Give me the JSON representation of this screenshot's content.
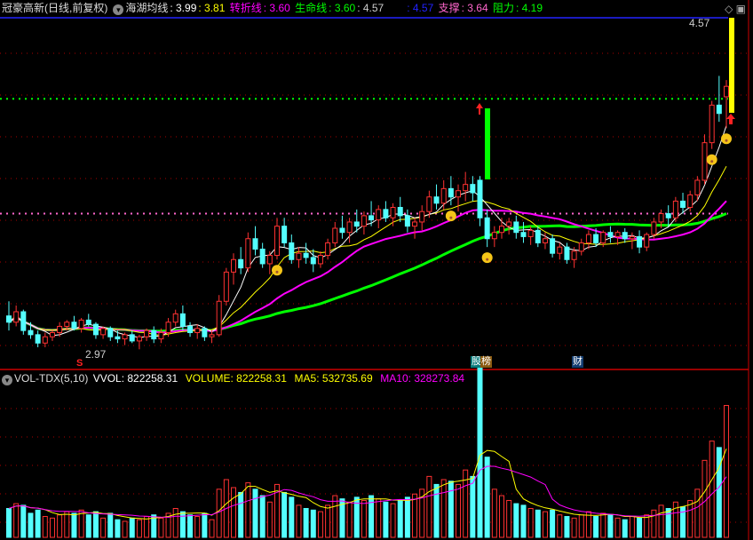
{
  "header": {
    "title": "冠豪高新(日线,前复权)",
    "ma_name": "海湖均线",
    "v1": ": 3.99",
    "v2": ": 3.81",
    "turn_label": "转折线",
    "turn_val": ": 3.60",
    "life_label": "生命线",
    "life_val": ": 3.60",
    "v3": ": 4.57",
    "v4": ": 4.57",
    "support_label": "支撑",
    "support_val": ": 3.64",
    "resist_label": "阻力",
    "resist_val": ": 4.19"
  },
  "vol_header": {
    "name": "VOL-TDX(5,10)",
    "vvol": "VVOL: 822258.31",
    "volume": "VOLUME: 822258.31",
    "ma5": "MA5: 532735.69",
    "ma10": "MA10: 328273.84"
  },
  "labels": {
    "high": "4.57",
    "low": "2.97",
    "tag1": "股",
    "tag2": "榜",
    "tag3": "财",
    "s_mark": "S"
  },
  "colors": {
    "up": "#ff3232",
    "down": "#54ffff",
    "ma_short": "#ffffff",
    "ma_mid": "#ffff00",
    "ma60": "#ff00ff",
    "ma120": "#00ff00",
    "grid": "#aa0000"
  },
  "price_range": [
    2.97,
    4.57
  ],
  "support": 3.64,
  "resistance": 4.19,
  "candles": [
    [
      3.15,
      3.22,
      3.08,
      3.12,
      180000
    ],
    [
      3.12,
      3.2,
      3.1,
      3.17,
      210000
    ],
    [
      3.17,
      3.18,
      3.06,
      3.08,
      200000
    ],
    [
      3.08,
      3.12,
      3.04,
      3.06,
      150000
    ],
    [
      3.06,
      3.08,
      3.0,
      3.02,
      170000
    ],
    [
      3.02,
      3.07,
      3.0,
      3.05,
      130000
    ],
    [
      3.05,
      3.08,
      3.03,
      3.07,
      120000
    ],
    [
      3.07,
      3.12,
      3.05,
      3.1,
      140000
    ],
    [
      3.1,
      3.13,
      3.08,
      3.12,
      160000
    ],
    [
      3.12,
      3.15,
      3.08,
      3.09,
      150000
    ],
    [
      3.09,
      3.14,
      3.07,
      3.13,
      170000
    ],
    [
      3.13,
      3.16,
      3.1,
      3.11,
      140000
    ],
    [
      3.11,
      3.12,
      3.04,
      3.06,
      160000
    ],
    [
      3.06,
      3.1,
      3.04,
      3.09,
      120000
    ],
    [
      3.09,
      3.1,
      3.03,
      3.05,
      150000
    ],
    [
      3.05,
      3.08,
      3.02,
      3.04,
      110000
    ],
    [
      3.04,
      3.07,
      3.01,
      3.06,
      100000
    ],
    [
      3.06,
      3.08,
      3.02,
      3.03,
      120000
    ],
    [
      3.03,
      3.06,
      2.99,
      3.05,
      110000
    ],
    [
      3.05,
      3.09,
      3.03,
      3.08,
      130000
    ],
    [
      3.08,
      3.1,
      3.02,
      3.04,
      140000
    ],
    [
      3.04,
      3.09,
      3.02,
      3.07,
      120000
    ],
    [
      3.07,
      3.14,
      3.05,
      3.12,
      150000
    ],
    [
      3.12,
      3.18,
      3.1,
      3.16,
      180000
    ],
    [
      3.16,
      3.2,
      3.08,
      3.1,
      160000
    ],
    [
      3.1,
      3.12,
      3.05,
      3.07,
      140000
    ],
    [
      3.07,
      3.11,
      3.04,
      3.09,
      130000
    ],
    [
      3.09,
      3.1,
      3.03,
      3.05,
      150000
    ],
    [
      3.05,
      3.08,
      3.02,
      3.06,
      110000
    ],
    [
      3.06,
      3.25,
      3.05,
      3.22,
      300000
    ],
    [
      3.22,
      3.38,
      3.2,
      3.36,
      360000
    ],
    [
      3.36,
      3.45,
      3.3,
      3.42,
      310000
    ],
    [
      3.42,
      3.48,
      3.35,
      3.38,
      280000
    ],
    [
      3.38,
      3.55,
      3.36,
      3.52,
      340000
    ],
    [
      3.52,
      3.58,
      3.44,
      3.47,
      300000
    ],
    [
      3.47,
      3.5,
      3.38,
      3.4,
      260000
    ],
    [
      3.4,
      3.46,
      3.35,
      3.44,
      220000
    ],
    [
      3.44,
      3.62,
      3.42,
      3.58,
      330000
    ],
    [
      3.58,
      3.62,
      3.48,
      3.5,
      280000
    ],
    [
      3.5,
      3.54,
      3.4,
      3.42,
      250000
    ],
    [
      3.42,
      3.48,
      3.38,
      3.45,
      200000
    ],
    [
      3.45,
      3.5,
      3.4,
      3.43,
      180000
    ],
    [
      3.43,
      3.47,
      3.36,
      3.4,
      170000
    ],
    [
      3.4,
      3.46,
      3.38,
      3.44,
      160000
    ],
    [
      3.44,
      3.52,
      3.42,
      3.5,
      200000
    ],
    [
      3.5,
      3.6,
      3.48,
      3.57,
      260000
    ],
    [
      3.57,
      3.63,
      3.52,
      3.55,
      240000
    ],
    [
      3.55,
      3.62,
      3.5,
      3.6,
      220000
    ],
    [
      3.6,
      3.66,
      3.55,
      3.58,
      250000
    ],
    [
      3.58,
      3.65,
      3.54,
      3.63,
      230000
    ],
    [
      3.63,
      3.7,
      3.58,
      3.61,
      260000
    ],
    [
      3.61,
      3.68,
      3.57,
      3.66,
      240000
    ],
    [
      3.66,
      3.7,
      3.6,
      3.62,
      220000
    ],
    [
      3.62,
      3.69,
      3.58,
      3.67,
      210000
    ],
    [
      3.67,
      3.72,
      3.6,
      3.63,
      230000
    ],
    [
      3.63,
      3.66,
      3.55,
      3.58,
      250000
    ],
    [
      3.58,
      3.62,
      3.52,
      3.6,
      270000
    ],
    [
      3.6,
      3.68,
      3.56,
      3.65,
      300000
    ],
    [
      3.65,
      3.75,
      3.62,
      3.72,
      380000
    ],
    [
      3.72,
      3.78,
      3.66,
      3.69,
      330000
    ],
    [
      3.69,
      3.8,
      3.66,
      3.76,
      360000
    ],
    [
      3.76,
      3.82,
      3.68,
      3.72,
      350000
    ],
    [
      3.72,
      3.78,
      3.65,
      3.75,
      330000
    ],
    [
      3.75,
      3.84,
      3.7,
      3.78,
      420000
    ],
    [
      3.78,
      3.82,
      3.7,
      3.74,
      380000
    ],
    [
      3.8,
      3.82,
      3.58,
      3.62,
      1080000
    ],
    [
      3.62,
      3.66,
      3.48,
      3.52,
      500000
    ],
    [
      3.52,
      3.58,
      3.48,
      3.55,
      300000
    ],
    [
      3.55,
      3.62,
      3.52,
      3.58,
      260000
    ],
    [
      3.58,
      3.62,
      3.54,
      3.6,
      230000
    ],
    [
      3.6,
      3.63,
      3.52,
      3.55,
      210000
    ],
    [
      3.55,
      3.6,
      3.5,
      3.53,
      200000
    ],
    [
      3.53,
      3.58,
      3.49,
      3.56,
      180000
    ],
    [
      3.56,
      3.58,
      3.48,
      3.5,
      170000
    ],
    [
      3.5,
      3.55,
      3.47,
      3.52,
      160000
    ],
    [
      3.52,
      3.54,
      3.43,
      3.45,
      170000
    ],
    [
      3.45,
      3.5,
      3.42,
      3.48,
      140000
    ],
    [
      3.48,
      3.5,
      3.4,
      3.42,
      130000
    ],
    [
      3.42,
      3.48,
      3.38,
      3.46,
      120000
    ],
    [
      3.46,
      3.52,
      3.44,
      3.5,
      140000
    ],
    [
      3.5,
      3.56,
      3.47,
      3.54,
      160000
    ],
    [
      3.54,
      3.57,
      3.48,
      3.5,
      130000
    ],
    [
      3.5,
      3.56,
      3.48,
      3.55,
      150000
    ],
    [
      3.55,
      3.58,
      3.5,
      3.53,
      140000
    ],
    [
      3.53,
      3.56,
      3.49,
      3.55,
      120000
    ],
    [
      3.55,
      3.57,
      3.5,
      3.52,
      110000
    ],
    [
      3.52,
      3.55,
      3.47,
      3.53,
      130000
    ],
    [
      3.53,
      3.56,
      3.45,
      3.48,
      120000
    ],
    [
      3.48,
      3.55,
      3.46,
      3.54,
      140000
    ],
    [
      3.54,
      3.62,
      3.52,
      3.6,
      170000
    ],
    [
      3.6,
      3.66,
      3.57,
      3.64,
      200000
    ],
    [
      3.64,
      3.68,
      3.58,
      3.62,
      180000
    ],
    [
      3.62,
      3.72,
      3.6,
      3.7,
      220000
    ],
    [
      3.7,
      3.74,
      3.64,
      3.67,
      190000
    ],
    [
      3.67,
      3.75,
      3.65,
      3.73,
      230000
    ],
    [
      3.73,
      3.82,
      3.7,
      3.8,
      300000
    ],
    [
      3.8,
      4.02,
      3.78,
      3.98,
      480000
    ],
    [
      3.98,
      4.18,
      3.95,
      4.16,
      600000
    ],
    [
      4.16,
      4.3,
      4.08,
      4.12,
      560000
    ],
    [
      4.2,
      4.28,
      4.05,
      4.25,
      822258.31
    ]
  ],
  "smiley_indices": [
    37,
    61,
    66,
    97,
    99
  ]
}
